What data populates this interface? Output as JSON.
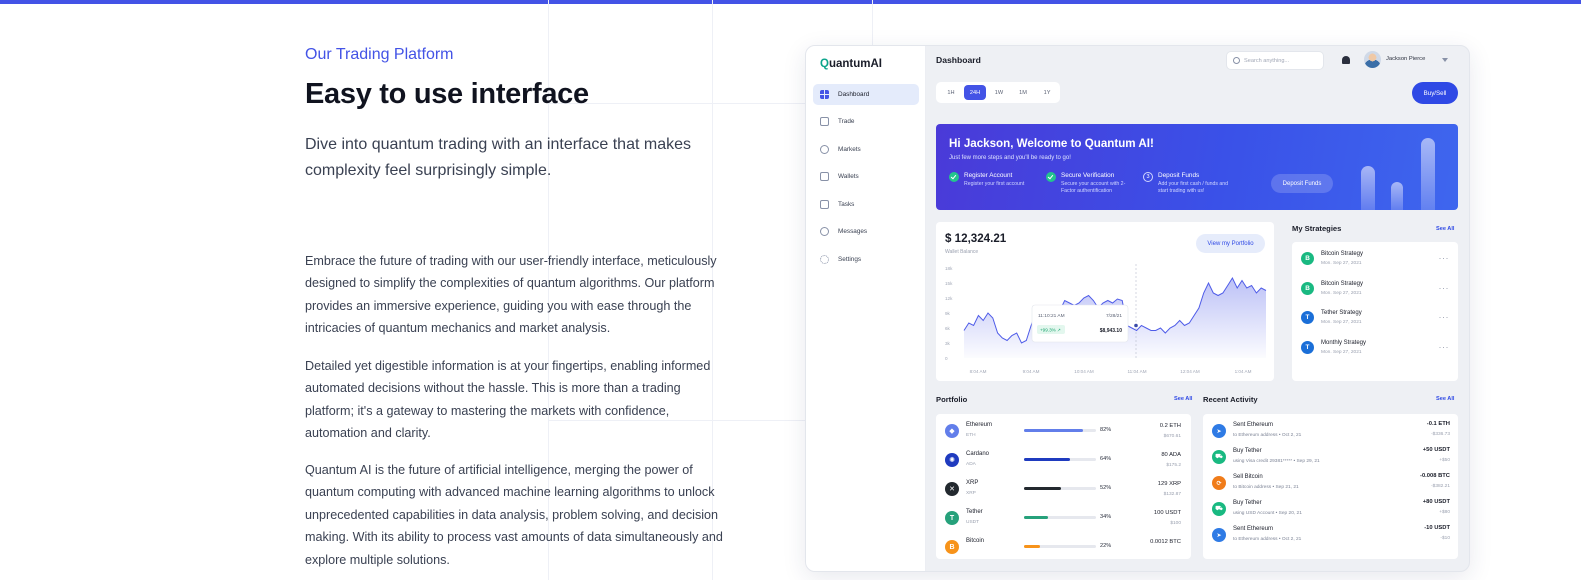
{
  "hero": {
    "eyebrow": "Our Trading Platform",
    "title": "Easy to use interface",
    "lead": "Dive into quantum trading with an interface that makes complexity feel surprisingly simple.",
    "paragraphs": [
      "Embrace the future of trading with our user-friendly interface, meticulously designed to simplify the complexities of quantum algorithms. Our platform provides an immersive experience, guiding you with ease through the intricacies of quantum mechanics and market analysis.",
      "Detailed yet digestible information is at your fingertips, enabling informed automated decisions without the hassle. This is more than a trading platform; it's a gateway to mastering the markets with confidence, automation and clarity.",
      "Quantum AI is the future of artificial intelligence, merging the power of quantum computing with advanced machine learning algorithms to unlock unprecedented capabilities in data analysis, problem solving, and decision making. With its ability to process vast amounts of data simultaneously and explore multiple solutions."
    ]
  },
  "app": {
    "logo_q": "Q",
    "logo_rest": "uantumAI",
    "nav": [
      "Dashboard",
      "Trade",
      "Markets",
      "Wallets",
      "Tasks",
      "Messages",
      "Settings"
    ],
    "title": "Dashboard",
    "search_placeholder": "Search anything...",
    "user_name": "Jackson Pierce",
    "timeframes": [
      "1H",
      "24H",
      "1W",
      "1M",
      "1Y"
    ],
    "buy_sell": "Buy/Sell"
  },
  "welcome": {
    "title": "Hi Jackson, Welcome to Quantum AI!",
    "subtitle": "Just few more steps and you'll be ready to go!",
    "steps": [
      {
        "title": "Register Account",
        "desc": "Register your first account",
        "marker": ""
      },
      {
        "title": "Secure Verification",
        "desc": "Secure your account with 2-Factor authentification",
        "marker": ""
      },
      {
        "title": "Deposit Funds",
        "desc": "Add your first cash / funds and start trading with us!",
        "marker": "3"
      }
    ],
    "deposit_button": "Deposit Funds"
  },
  "wallet": {
    "balance": "$ 12,324.21",
    "balance_label": "Wallet Balance",
    "view_button": "View my Portfolio",
    "tooltip_time": "11:10:21 AM",
    "tooltip_date": "7/28/21",
    "tooltip_change": "+99.3% ↗",
    "tooltip_value": "$8,943.10"
  },
  "chart_data": {
    "type": "area",
    "x": [
      "8:04 AM",
      "9:04 AM",
      "10:04 AM",
      "11:04 AM",
      "12:04 AM",
      "1:04 AM"
    ],
    "y_ticks": [
      "18k",
      "15k",
      "12k",
      "9k",
      "6k",
      "3k",
      "0"
    ],
    "ylim": [
      0,
      18
    ],
    "values": [
      5.5,
      7,
      6.5,
      8.5,
      7.5,
      9,
      8,
      5,
      4,
      3.5,
      4.5,
      5,
      3,
      3.5,
      6.5,
      9,
      9.5,
      8,
      9.5,
      10,
      9.5,
      11.5,
      11,
      10.5,
      11,
      12,
      12.5,
      11.5,
      10,
      11,
      11.5,
      11,
      11.8,
      11.5,
      6.5,
      6,
      5.5,
      6.5,
      6,
      5.5,
      5.5,
      6,
      5,
      6,
      6.5,
      7.5,
      6.5,
      7,
      8.5,
      10,
      13,
      15,
      13,
      12.5,
      13,
      14.5,
      16,
      14,
      15.5,
      14,
      14.5,
      13,
      14,
      13.5
    ],
    "grid": false,
    "legend": "none",
    "color": "#4e5be8"
  },
  "strategies": {
    "title": "My Strategies",
    "see_all": "See All",
    "items": [
      {
        "name": "Bitcoin Strategy",
        "date": "Mon. Sep 27, 2021",
        "letter": "B",
        "color": "#19b981"
      },
      {
        "name": "Bitcoin Strategy",
        "date": "Mon. Sep 27, 2021",
        "letter": "B",
        "color": "#19b981"
      },
      {
        "name": "Tether Strategy",
        "date": "Mon. Sep 27, 2021",
        "letter": "T",
        "color": "#1b6fd8"
      },
      {
        "name": "Monthly Strategy",
        "date": "Mon. Sep 27, 2021",
        "letter": "T",
        "color": "#1b6fd8"
      }
    ],
    "more": "···"
  },
  "portfolio": {
    "title": "Portfolio",
    "see_all": "See All",
    "items": [
      {
        "name": "Ethereum",
        "symbol": "ETH",
        "percent": 82,
        "percent_label": "82%",
        "amount": "0.2 ETH",
        "usd": "$670.61",
        "color": "#627eea",
        "bar": "#627eea",
        "glyph": "◆"
      },
      {
        "name": "Cardano",
        "symbol": "ADA",
        "percent": 64,
        "percent_label": "64%",
        "amount": "80 ADA",
        "usd": "$175.2",
        "color": "#1f3bbf",
        "bar": "#1f3bbf",
        "glyph": "✺"
      },
      {
        "name": "XRP",
        "symbol": "XRP",
        "percent": 52,
        "percent_label": "52%",
        "amount": "129 XRP",
        "usd": "$132.87",
        "color": "#23292f",
        "bar": "#23292f",
        "glyph": "✕"
      },
      {
        "name": "Tether",
        "symbol": "USDT",
        "percent": 34,
        "percent_label": "34%",
        "amount": "100 USDT",
        "usd": "$100",
        "color": "#26a17b",
        "bar": "#26a17b",
        "glyph": "T"
      },
      {
        "name": "Bitcoin",
        "symbol": "",
        "percent": 22,
        "percent_label": "22%",
        "amount": "0.0012 BTC",
        "usd": "",
        "color": "#f7931a",
        "bar": "#f7931a",
        "glyph": "B"
      }
    ]
  },
  "activity": {
    "title": "Recent Activity",
    "see_all": "See All",
    "items": [
      {
        "name": "Sent Ethereum",
        "sub": "to Ethereum address • Oct 2, 21",
        "amount": "-0.1 ETH",
        "usd": "-$336.73",
        "color": "#2f7be5",
        "glyph": "➤"
      },
      {
        "name": "Buy Tether",
        "sub": "using Visa credit 29381***** • Sep 29, 21",
        "amount": "+50 USDT",
        "usd": "+$50",
        "color": "#19b981",
        "glyph": "⛟"
      },
      {
        "name": "Sell Bitcoin",
        "sub": "to Bitcoin address • Sep 21, 21",
        "amount": "-0.008 BTC",
        "usd": "-$382.21",
        "color": "#f07c1a",
        "glyph": "⟳"
      },
      {
        "name": "Buy Tether",
        "sub": "using USD Account • Sep 20, 21",
        "amount": "+80 USDT",
        "usd": "+$80",
        "color": "#19b981",
        "glyph": "⛟"
      },
      {
        "name": "Sent Ethereum",
        "sub": "to Ethereum address • Oct 2, 21",
        "amount": "-10 USDT",
        "usd": "-$10",
        "color": "#2f7be5",
        "glyph": "➤"
      }
    ]
  }
}
